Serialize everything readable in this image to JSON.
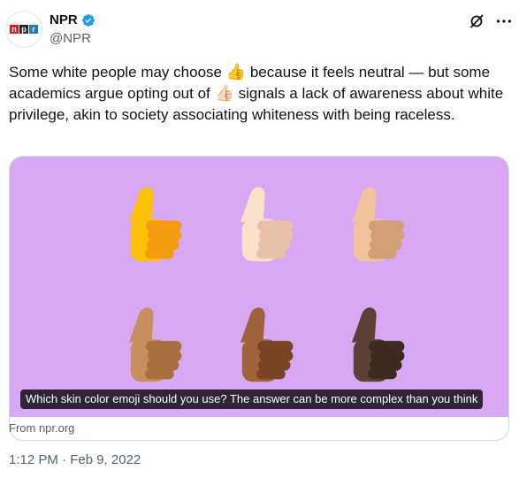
{
  "author": {
    "name": "NPR",
    "handle": "@NPR",
    "logo_letters": [
      "n",
      "p",
      "r"
    ],
    "verified": true
  },
  "tweet": {
    "text_part1": "Some white people may choose ",
    "emoji1": "👍",
    "text_part2": " because it feels neutral — but some academics argue opting out of ",
    "emoji2": "👍🏻",
    "text_part3": " signals a lack of awareness about white privilege, akin to society associating whiteness with being raceless."
  },
  "card": {
    "caption": "Which skin color emoji should you use? The answer can be more complex than you think",
    "source": "From npr.org",
    "background_color": "#d8a8f5",
    "thumb_colors": [
      {
        "tone": "yellow",
        "base": "#ffc107",
        "shade": "#f39c12"
      },
      {
        "tone": "light",
        "base": "#fbe0cc",
        "shade": "#e8c1a6"
      },
      {
        "tone": "medium-light",
        "base": "#f0c39a",
        "shade": "#d49f76"
      },
      {
        "tone": "medium",
        "base": "#c98e5e",
        "shade": "#a8703f"
      },
      {
        "tone": "medium-dark",
        "base": "#a0623a",
        "shade": "#7a4524"
      },
      {
        "tone": "dark",
        "base": "#5c4033",
        "shade": "#3d2a20"
      }
    ]
  },
  "timestamp": "1:12 PM · Feb 9, 2022",
  "colors": {
    "text": "#0f1419",
    "secondary": "#536471",
    "verified": "#1d9bf0",
    "border": "#cfd9de"
  }
}
